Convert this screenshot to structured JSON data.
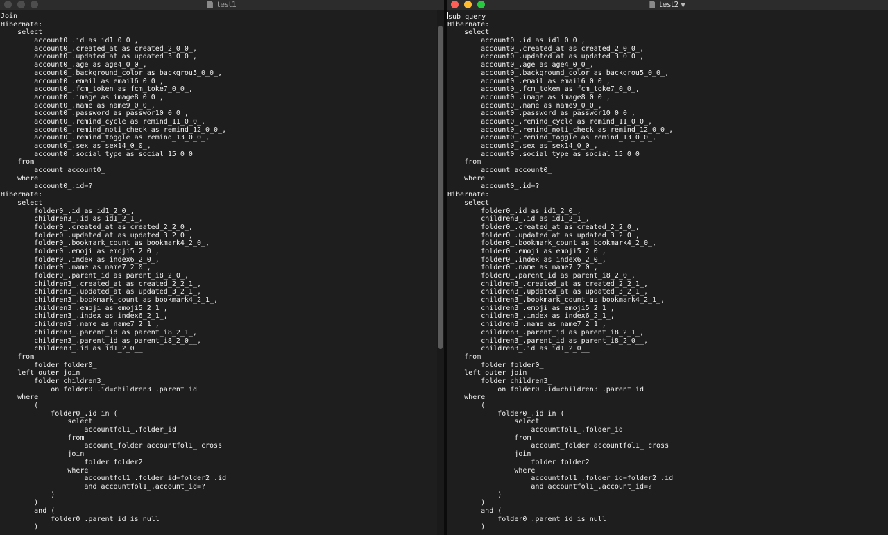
{
  "left_window": {
    "title": "test1",
    "lines": [
      "Join",
      "Hibernate:",
      "    select",
      "        account0_.id as id1_0_0_,",
      "        account0_.created_at as created_2_0_0_,",
      "        account0_.updated_at as updated_3_0_0_,",
      "        account0_.age as age4_0_0_,",
      "        account0_.background_color as backgrou5_0_0_,",
      "        account0_.email as email6_0_0_,",
      "        account0_.fcm_token as fcm_toke7_0_0_,",
      "        account0_.image as image8_0_0_,",
      "        account0_.name as name9_0_0_,",
      "        account0_.password as passwor10_0_0_,",
      "        account0_.remind_cycle as remind_11_0_0_,",
      "        account0_.remind_noti_check as remind_12_0_0_,",
      "        account0_.remind_toggle as remind_13_0_0_,",
      "        account0_.sex as sex14_0_0_,",
      "        account0_.social_type as social_15_0_0_",
      "    from",
      "        account account0_",
      "    where",
      "        account0_.id=?",
      "Hibernate:",
      "    select",
      "        folder0_.id as id1_2_0_,",
      "        children3_.id as id1_2_1_,",
      "        folder0_.created_at as created_2_2_0_,",
      "        folder0_.updated_at as updated_3_2_0_,",
      "        folder0_.bookmark_count as bookmark4_2_0_,",
      "        folder0_.emoji as emoji5_2_0_,",
      "        folder0_.index as index6_2_0_,",
      "        folder0_.name as name7_2_0_,",
      "        folder0_.parent_id as parent_i8_2_0_,",
      "        children3_.created_at as created_2_2_1_,",
      "        children3_.updated_at as updated_3_2_1_,",
      "        children3_.bookmark_count as bookmark4_2_1_,",
      "        children3_.emoji as emoji5_2_1_,",
      "        children3_.index as index6_2_1_,",
      "        children3_.name as name7_2_1_,",
      "        children3_.parent_id as parent_i8_2_1_,",
      "        children3_.parent_id as parent_i8_2_0__,",
      "        children3_.id as id1_2_0__",
      "    from",
      "        folder folder0_",
      "    left outer join",
      "        folder children3_",
      "            on folder0_.id=children3_.parent_id",
      "    where",
      "        (",
      "            folder0_.id in (",
      "                select",
      "                    accountfol1_.folder_id",
      "                from",
      "                    account_folder accountfol1_ cross",
      "                join",
      "                    folder folder2_",
      "                where",
      "                    accountfol1_.folder_id=folder2_.id",
      "                    and accountfol1_.account_id=?",
      "            )",
      "        )",
      "        and (",
      "            folder0_.parent_id is null",
      "        )"
    ]
  },
  "right_window": {
    "title": "test2",
    "lines": [
      "sub query",
      "Hibernate:",
      "    select",
      "        account0_.id as id1_0_0_,",
      "        account0_.created_at as created_2_0_0_,",
      "        account0_.updated_at as updated_3_0_0_,",
      "        account0_.age as age4_0_0_,",
      "        account0_.background_color as backgrou5_0_0_,",
      "        account0_.email as email6_0_0_,",
      "        account0_.fcm_token as fcm_toke7_0_0_,",
      "        account0_.image as image8_0_0_,",
      "        account0_.name as name9_0_0_,",
      "        account0_.password as passwor10_0_0_,",
      "        account0_.remind_cycle as remind_11_0_0_,",
      "        account0_.remind_noti_check as remind_12_0_0_,",
      "        account0_.remind_toggle as remind_13_0_0_,",
      "        account0_.sex as sex14_0_0_,",
      "        account0_.social_type as social_15_0_0_",
      "    from",
      "        account account0_",
      "    where",
      "        account0_.id=?",
      "Hibernate:",
      "    select",
      "        folder0_.id as id1_2_0_,",
      "        children3_.id as id1_2_1_,",
      "        folder0_.created_at as created_2_2_0_,",
      "        folder0_.updated_at as updated_3_2_0_,",
      "        folder0_.bookmark_count as bookmark4_2_0_,",
      "        folder0_.emoji as emoji5_2_0_,",
      "        folder0_.index as index6_2_0_,",
      "        folder0_.name as name7_2_0_,",
      "        folder0_.parent_id as parent_i8_2_0_,",
      "        children3_.created_at as created_2_2_1_,",
      "        children3_.updated_at as updated_3_2_1_,",
      "        children3_.bookmark_count as bookmark4_2_1_,",
      "        children3_.emoji as emoji5_2_1_,",
      "        children3_.index as index6_2_1_,",
      "        children3_.name as name7_2_1_,",
      "        children3_.parent_id as parent_i8_2_1_,",
      "        children3_.parent_id as parent_i8_2_0__,",
      "        children3_.id as id1_2_0__",
      "    from",
      "        folder folder0_",
      "    left outer join",
      "        folder children3_",
      "            on folder0_.id=children3_.parent_id",
      "    where",
      "        (",
      "            folder0_.id in (",
      "                select",
      "                    accountfol1_.folder_id",
      "                from",
      "                    account_folder accountfol1_ cross",
      "                join",
      "                    folder folder2_",
      "                where",
      "                    accountfol1_.folder_id=folder2_.id",
      "                    and accountfol1_.account_id=?",
      "            )",
      "        )",
      "        and (",
      "            folder0_.parent_id is null",
      "        )"
    ]
  },
  "colors": {
    "editor_bg": "#1e1e1e",
    "text": "#f2f2f2",
    "close": "#ff5f57",
    "minimize": "#febc2e",
    "zoom": "#28c840"
  },
  "icons": {
    "document": "document-icon",
    "title_menu": "chevron-down-icon"
  }
}
